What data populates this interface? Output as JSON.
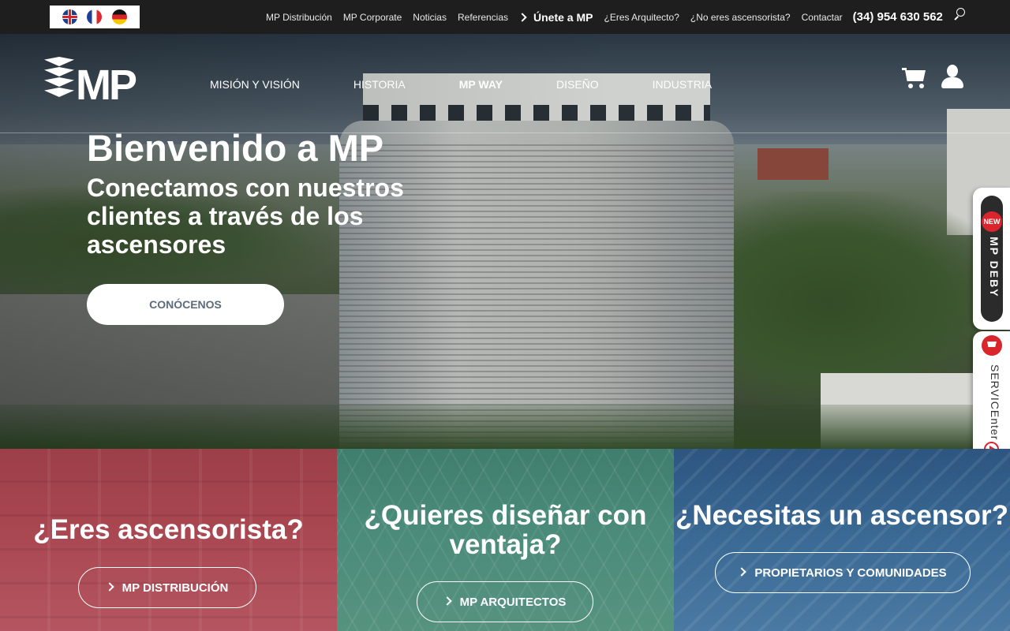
{
  "topbar": {
    "flags": [
      "uk-flag-icon",
      "fr-flag-icon",
      "de-flag-icon"
    ],
    "links": [
      {
        "label": "MP Distribución"
      },
      {
        "label": "MP Corporate"
      },
      {
        "label": "Noticias"
      },
      {
        "label": "Referencias"
      },
      {
        "label": "Únete a MP",
        "bold": true
      },
      {
        "label": "¿Eres Arquitecto?"
      },
      {
        "label": "¿No eres ascensorista?"
      },
      {
        "label": "Contactar"
      }
    ],
    "phone": "(34) 954 630 562"
  },
  "logo": {
    "text": "MP"
  },
  "mainnav": {
    "items": [
      "MISIÓN Y VISIÓN",
      "HISTORIA",
      "MP WAY",
      "DISEÑO",
      "INDUSTRIA"
    ],
    "active_index": 2
  },
  "hero": {
    "title": "Bienvenido a MP",
    "subtitle": "Conectamos con nuestros clientes a través de los ascensores",
    "cta": "CONÓCENOS"
  },
  "sidetabs": {
    "new_badge": "NEW",
    "deby_label": "MP DEBY",
    "service_label": "SERVICEnter"
  },
  "panels": [
    {
      "title": "¿Eres ascensorista?",
      "button": "MP DISTRIBUCIÓN",
      "color": "#a84650"
    },
    {
      "title": "¿Quieres diseñar con ventaja?",
      "button": "MP ARQUITECTOS",
      "color": "#4a8a79"
    },
    {
      "title": "¿Necesitas un ascensor?",
      "button": "PROPIETARIOS Y COMUNIDADES",
      "color": "#3a6a95"
    }
  ]
}
